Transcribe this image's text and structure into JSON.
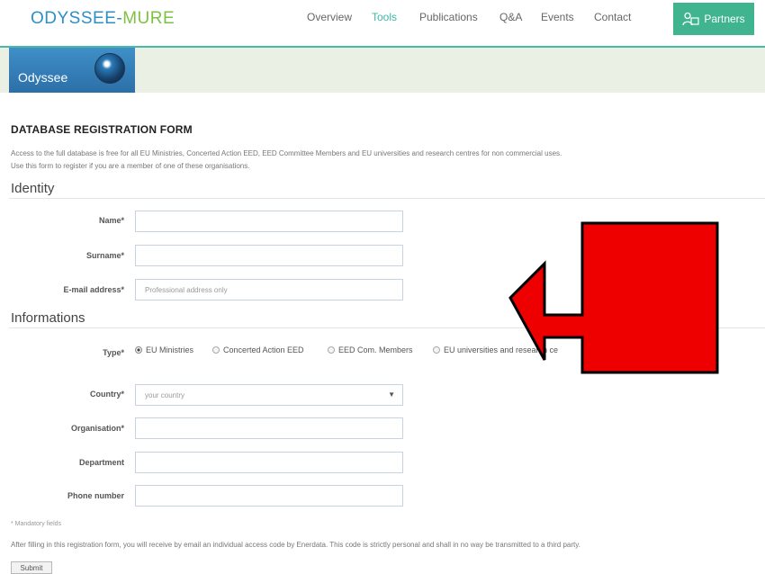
{
  "header": {
    "brand_part1": "ODYSSEE-",
    "brand_part2": "MURE",
    "nav": [
      {
        "label": "Overview"
      },
      {
        "label": "Tools",
        "active": true
      },
      {
        "label": "Publications"
      },
      {
        "label": "Q&A"
      },
      {
        "label": "Events"
      },
      {
        "label": "Contact"
      }
    ],
    "partners_label": "Partners",
    "partners_icon": "people-icon"
  },
  "banner": {
    "logo_text": "Odyssee",
    "logo_icon": "globe-icon"
  },
  "form": {
    "title": "DATABASE REGISTRATION FORM",
    "description_line1": "Access to the full database is free for all EU Ministries, Concerted Action EED, EED Committee Members and EU universities and research centres for non commercial uses.",
    "description_line2": "Use this form to register if you are a member of one of these organisations.",
    "identity": {
      "heading": "Identity",
      "name_label": "Name*",
      "surname_label": "Surname*",
      "email_label": "E-mail address*",
      "email_placeholder": "Professional address only"
    },
    "informations": {
      "heading": "Informations",
      "type_label": "Type*",
      "type_options": [
        {
          "label": "EU Ministries",
          "selected": true
        },
        {
          "label": "Concerted Action EED",
          "selected": false
        },
        {
          "label": "EED Com. Members",
          "selected": false
        },
        {
          "label": "EU universities and research ce",
          "selected": false
        }
      ],
      "country_label": "Country*",
      "country_value": "your country",
      "organisation_label": "Organisation*",
      "department_label": "Department",
      "phone_label": "Phone number"
    },
    "mandatory_note": "* Mandatory fields",
    "footer_note": "After filling in this registration form, you will receive by email an individual access code by Enerdata. This code is strictly personal and shall in no way be transmitted to a third party.",
    "submit_label": "Submit"
  },
  "colors": {
    "accent": "#3fb7a8",
    "brand_blue": "#2e8fc4",
    "brand_green": "#7dc242",
    "arrow": "#ee0000"
  }
}
